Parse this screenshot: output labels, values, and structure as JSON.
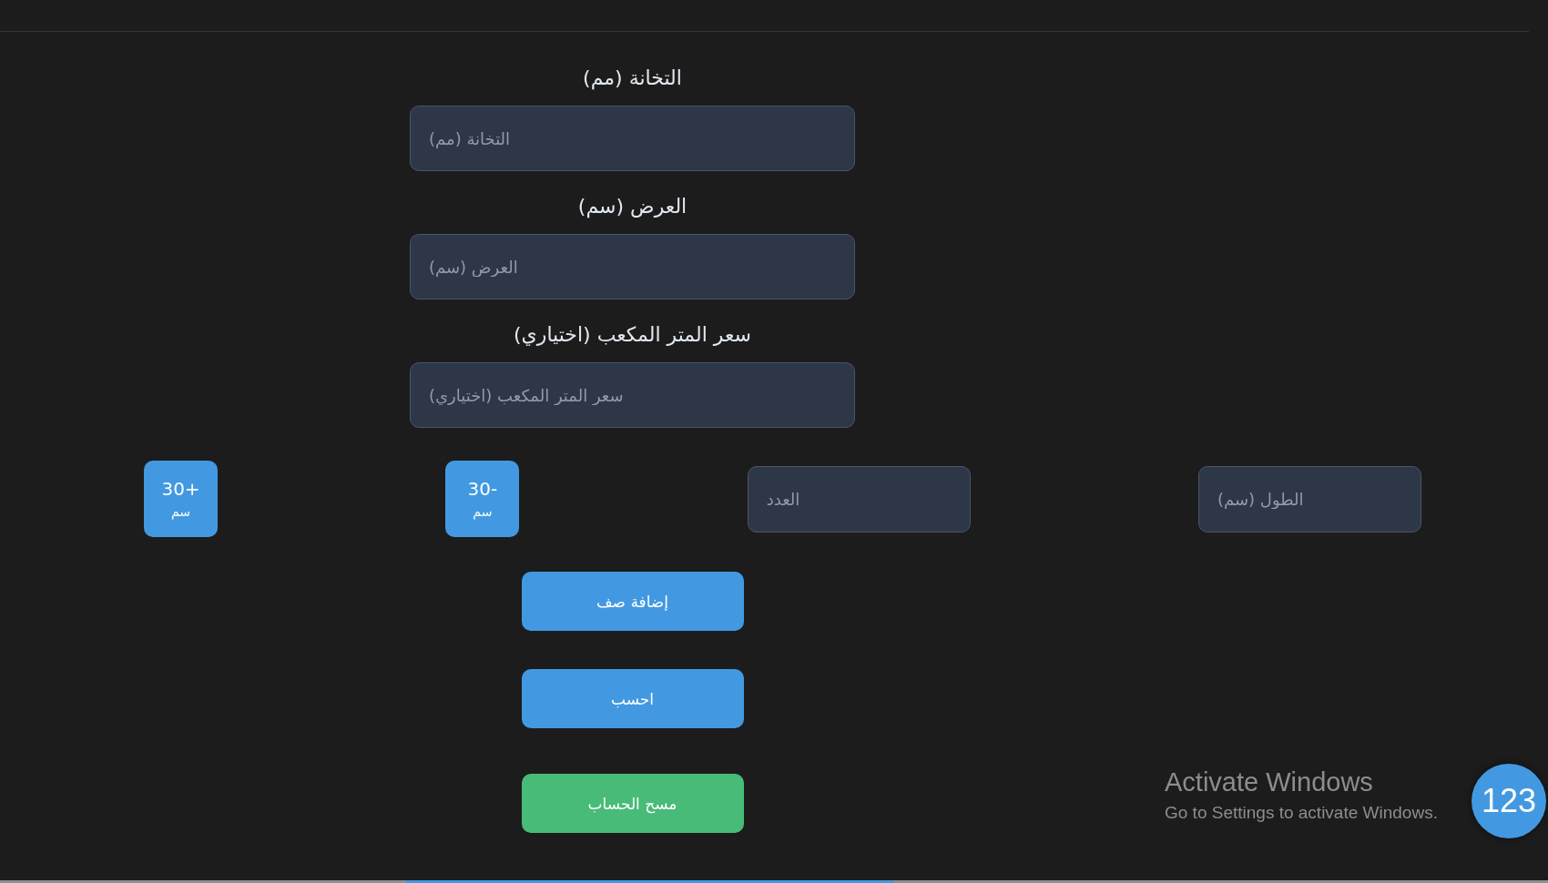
{
  "fields": [
    {
      "label": "التخانة (مم)",
      "placeholder": "التخانة (مم)"
    },
    {
      "label": "العرض (سم)",
      "placeholder": "العرض (سم)"
    },
    {
      "label": "سعر المتر المكعب (اختياري)",
      "placeholder": "سعر المتر المكعب (اختياري)"
    }
  ],
  "row": [
    {
      "kind": "input",
      "placeholder": "الطول (سم)"
    },
    {
      "kind": "input",
      "placeholder": "العدد"
    },
    {
      "kind": "button",
      "value": "30-",
      "unit": "سم"
    },
    {
      "kind": "button",
      "value": "30+",
      "unit": "سم"
    }
  ],
  "actions": [
    {
      "kind": "primary",
      "label": "إضافة صف"
    },
    {
      "kind": "primary",
      "label": "احسب"
    },
    {
      "kind": "success",
      "label": "مسح الحساب"
    }
  ],
  "activation_notice": {
    "title": "Activate Windows",
    "message": "Go to Settings to activate Windows."
  },
  "floating_button": {
    "label": "123"
  }
}
